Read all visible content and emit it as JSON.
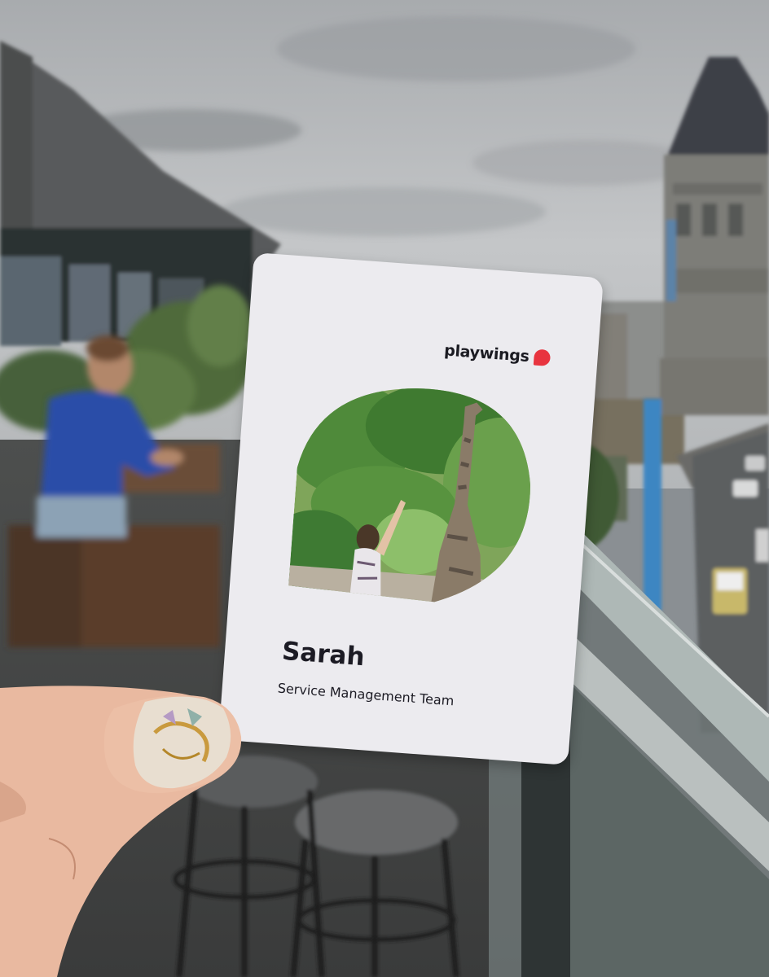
{
  "card": {
    "brand": "playwings",
    "name": "Sarah",
    "team": "Service Management Team"
  },
  "colors": {
    "brand_dot": "#e8343f",
    "card_bg": "#ecebef",
    "text": "#1c1b24",
    "sky": "#b9bcbf",
    "jacket": "#2a4ea8"
  }
}
